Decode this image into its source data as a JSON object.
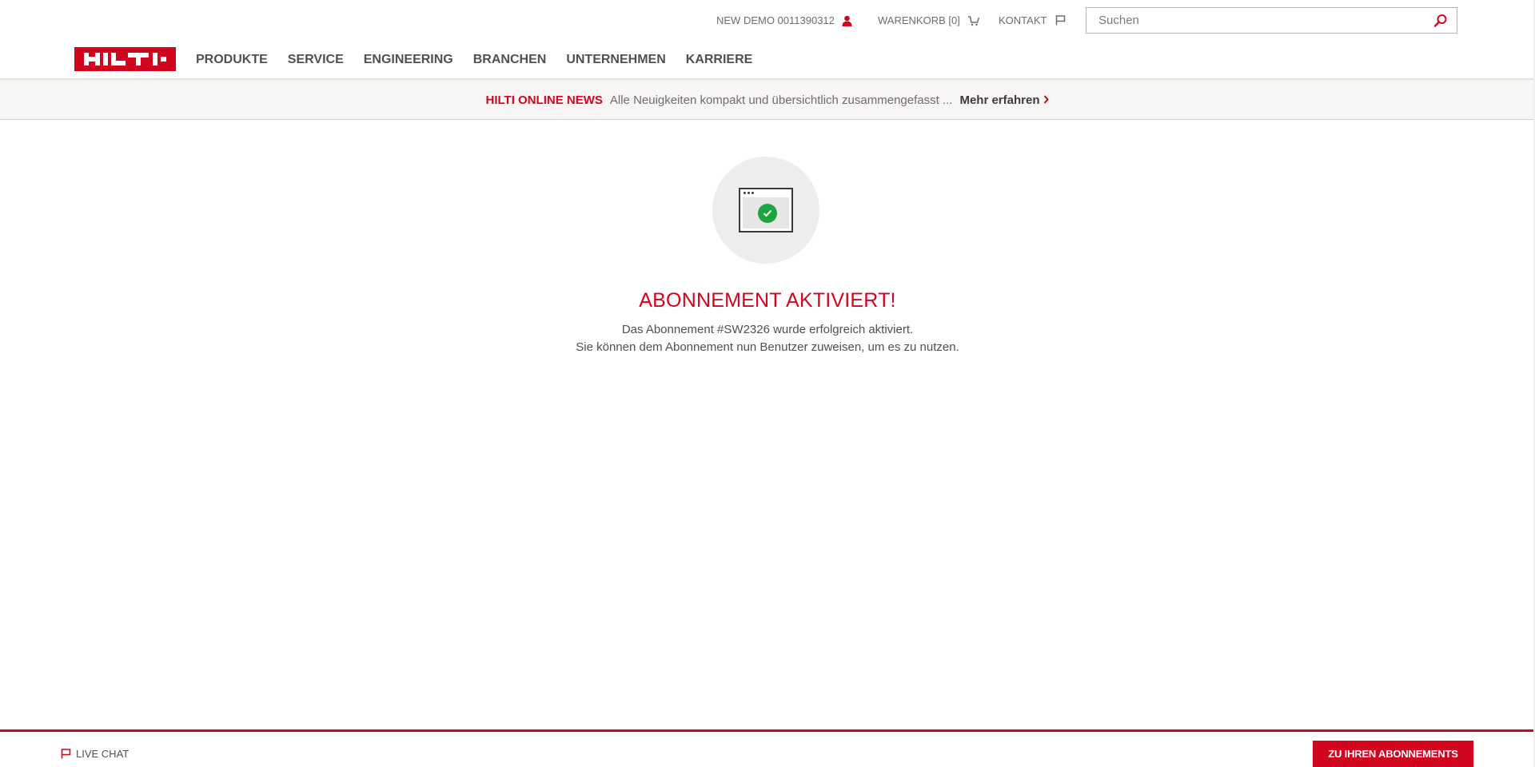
{
  "header": {
    "account_label": "NEW DEMO 0011390312",
    "cart_label": "WARENKORB [0]",
    "contact_label": "KONTAKT",
    "search": {
      "placeholder": "Suchen",
      "value": ""
    },
    "logo_text": "HILTI"
  },
  "nav": {
    "items": [
      {
        "label": "PRODUKTE"
      },
      {
        "label": "SERVICE"
      },
      {
        "label": "ENGINEERING"
      },
      {
        "label": "BRANCHEN"
      },
      {
        "label": "UNTERNEHMEN"
      },
      {
        "label": "KARRIERE"
      }
    ]
  },
  "news": {
    "title": "HILTI ONLINE NEWS",
    "text": "Alle Neuigkeiten kompakt und übersichtlich zusammengefasst ...",
    "link": "Mehr erfahren"
  },
  "main": {
    "status_icon": "browser-window-check-icon",
    "headline": "ABONNEMENT AKTIVIERT!",
    "message_line1": "Das Abonnement #SW2326 wurde erfolgreich aktiviert.",
    "message_line2": "Sie können dem Abonnement nun Benutzer zuweisen, um es zu nutzen."
  },
  "footer": {
    "live_chat_label": "LIVE CHAT",
    "cta_label": "ZU IHREN ABONNEMENTS"
  },
  "colors": {
    "brand_red": "#d2051e",
    "success_green": "#1fa442",
    "text_gray": "#524f53"
  }
}
